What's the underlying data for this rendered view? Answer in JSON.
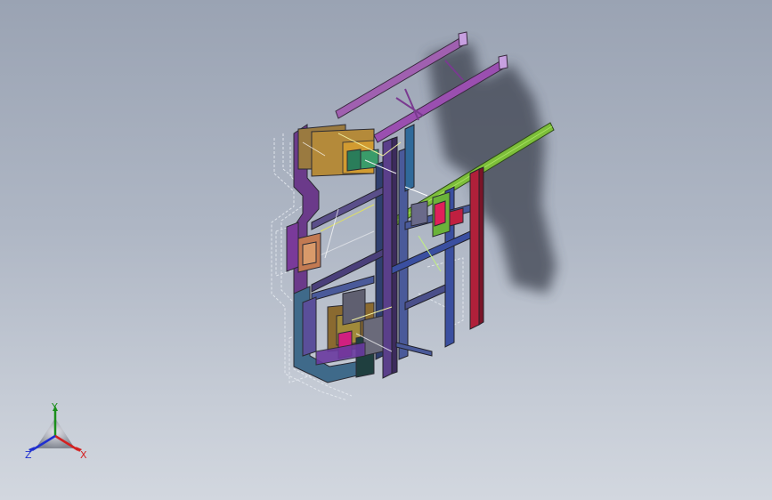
{
  "viewport": {
    "background_top": "#9aa3b3",
    "background_bottom": "#d2d7df"
  },
  "model": {
    "icon": "isometric-steel-frame-assembly",
    "shadow_color": "#3e4350"
  },
  "triad": {
    "x_label": "X",
    "y_label": "Y",
    "z_label": "Z",
    "x_color": "#d42020",
    "y_color": "#1b8f1b",
    "z_color": "#1f2fd0"
  }
}
